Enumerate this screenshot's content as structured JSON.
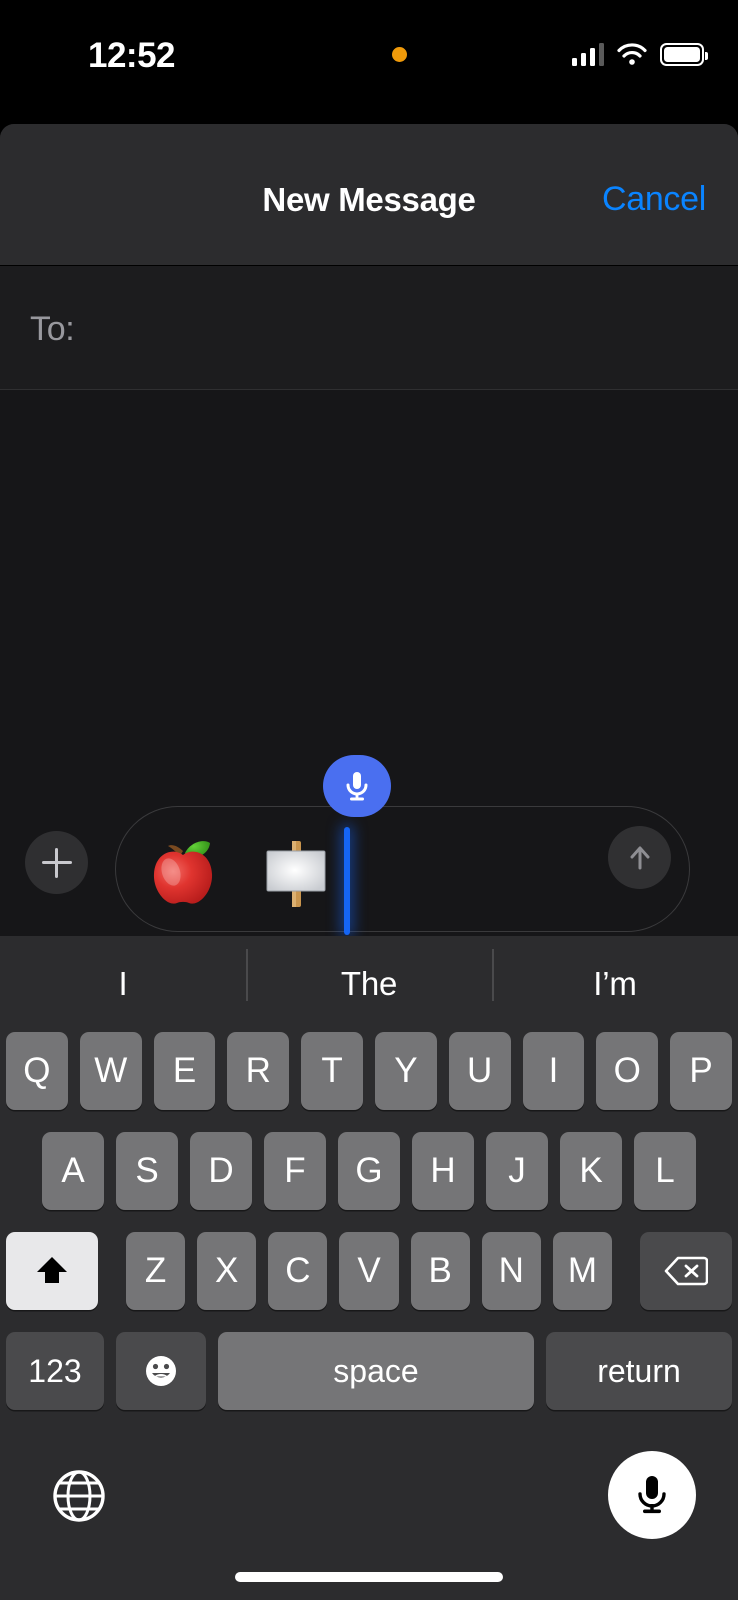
{
  "status_bar": {
    "time": "12:52",
    "recording_indicator": "orange-dot-icon",
    "cellular_icon": "cellular-signal-icon",
    "wifi_icon": "wifi-icon",
    "battery_icon": "battery-icon",
    "accent_orange": "#F09A0A"
  },
  "navbar": {
    "title": "New Message",
    "cancel_label": "Cancel",
    "cancel_color": "#0a84ff"
  },
  "recipient_field": {
    "label": "To:",
    "value": "",
    "placeholder": ""
  },
  "composer": {
    "attach_icon": "plus-icon",
    "send_icon": "arrow-up-icon",
    "dictation_badge_icon": "microphone-icon",
    "input_value": "🍎🪧",
    "emoji_1": "red-apple-emoji",
    "emoji_2": "placard-sign-emoji",
    "caret_color": "#1565f5",
    "dictation_badge_color": "#4a6ff0"
  },
  "keyboard": {
    "predictions": [
      "I",
      "The",
      "I’m"
    ],
    "row1": [
      "Q",
      "W",
      "E",
      "R",
      "T",
      "Y",
      "U",
      "I",
      "O",
      "P"
    ],
    "row2": [
      "A",
      "S",
      "D",
      "F",
      "G",
      "H",
      "J",
      "K",
      "L"
    ],
    "row3": [
      "Z",
      "X",
      "C",
      "V",
      "B",
      "N",
      "M"
    ],
    "shift_icon": "shift-arrow-icon",
    "shift_active": "true",
    "delete_icon": "backspace-icon",
    "numbers_label": "123",
    "emoji_key_icon": "smiley-face-icon",
    "space_label": "space",
    "return_label": "return",
    "globe_icon": "globe-icon",
    "dictation_icon": "microphone-icon"
  }
}
